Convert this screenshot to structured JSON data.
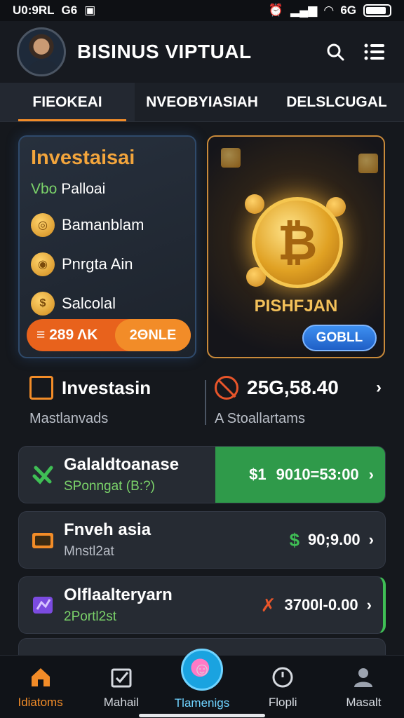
{
  "status_bar": {
    "left_text": "U0:9RL",
    "carrier": "G6",
    "right_text": "6G"
  },
  "header": {
    "title": "BISINUS VIPTUAL"
  },
  "tabs": [
    {
      "label": "FIEOKEAI",
      "active": true
    },
    {
      "label": "NVEOBYIASIAH",
      "active": false
    },
    {
      "label": "DELSLCUGAL",
      "active": false
    }
  ],
  "invest_card": {
    "title": "Investaisai",
    "subtitle_tag": "Vbo",
    "subtitle": "Palloai",
    "rows": [
      {
        "label": "Bamanblam",
        "icon": "coin-icon"
      },
      {
        "label": "Pnrgta Ain",
        "icon": "coins-stack-icon"
      },
      {
        "label": "Salcolal",
        "icon": "dollar-coin-icon"
      }
    ],
    "pill_left": "≡ 289 ΛΚ",
    "pill_right": "2ΘΝLE"
  },
  "promo_card": {
    "title": "PISHFJAN",
    "button": "GOBLL",
    "coin_symbol": "₿"
  },
  "summary": {
    "title": "Investasin",
    "subtitle": "Mastlanvads",
    "value": "25G,58.40",
    "note": "A Stoallartams"
  },
  "transactions": [
    {
      "name": "Galaldtoanase",
      "sub": "SPonngat (B:?)",
      "currency": "$1",
      "amount": "9010=53:00",
      "icon": "check-x-icon",
      "highlight": true
    },
    {
      "name": "Fnveh asia",
      "sub": "Mnstl2at",
      "currency": "$",
      "amount": "90;9.00",
      "icon": "wallet-icon",
      "highlight": false
    },
    {
      "name": "Olflaalteryarn",
      "sub": "2Portl2st",
      "currency": "✗",
      "amount": "3700l-0.00",
      "icon": "chart-card-icon",
      "highlight": false
    }
  ],
  "bottom_nav": [
    {
      "label": "Idiatoms",
      "icon": "home-icon",
      "active": true
    },
    {
      "label": "Mahail",
      "icon": "checkbox-icon",
      "active": false
    },
    {
      "label": "Tlamenigs",
      "icon": "smiley-fab-icon",
      "active": false
    },
    {
      "label": "Flopli",
      "icon": "clock-icon",
      "active": false
    },
    {
      "label": "Masalt",
      "icon": "user-icon",
      "active": false
    }
  ],
  "colors": {
    "accent": "#f28c28",
    "green": "#2f9a4a",
    "blue": "#2f78e0",
    "background": "#15181d"
  }
}
